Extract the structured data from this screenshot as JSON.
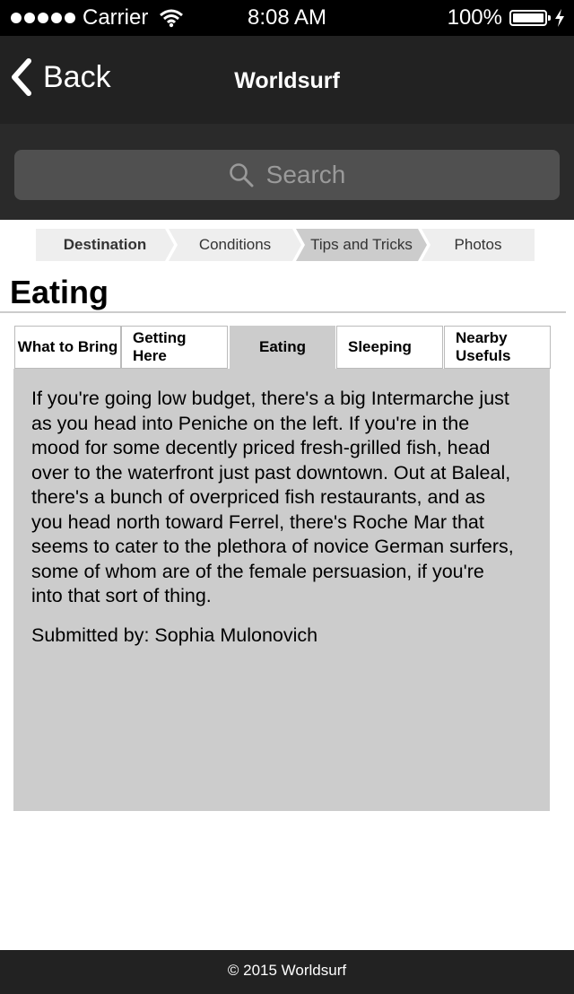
{
  "status_bar": {
    "carrier": "Carrier",
    "time": "8:08 AM",
    "battery": "100%"
  },
  "nav": {
    "back_label": "Back",
    "title": "Worldsurf"
  },
  "search": {
    "placeholder": "Search"
  },
  "steps": [
    {
      "label": "Destination"
    },
    {
      "label": "Conditions"
    },
    {
      "label": "Tips and Tricks"
    },
    {
      "label": "Photos"
    }
  ],
  "page": {
    "title": "Eating"
  },
  "tabs": [
    {
      "label": "What to Bring"
    },
    {
      "label": "Getting Here"
    },
    {
      "label": "Eating"
    },
    {
      "label": "Sleeping"
    },
    {
      "label": "Nearby Usefuls"
    }
  ],
  "content": {
    "text": "If you're going low budget, there's a big Intermarche just as you head into Peniche on the left. If you're in the mood for some decently priced fresh-grilled fish, head over to the waterfront just past downtown. Out at Baleal, there's a bunch of overpriced fish restaurants, and as you head north toward Ferrel, there's Roche Mar that seems to cater to the plethora of novice German surfers, some of whom are of the female persuasion, if you're into that sort of thing.",
    "submitted_by": "Submitted by: Sophia Mulonovich"
  },
  "footer": {
    "text": "© 2015 Worldsurf"
  }
}
